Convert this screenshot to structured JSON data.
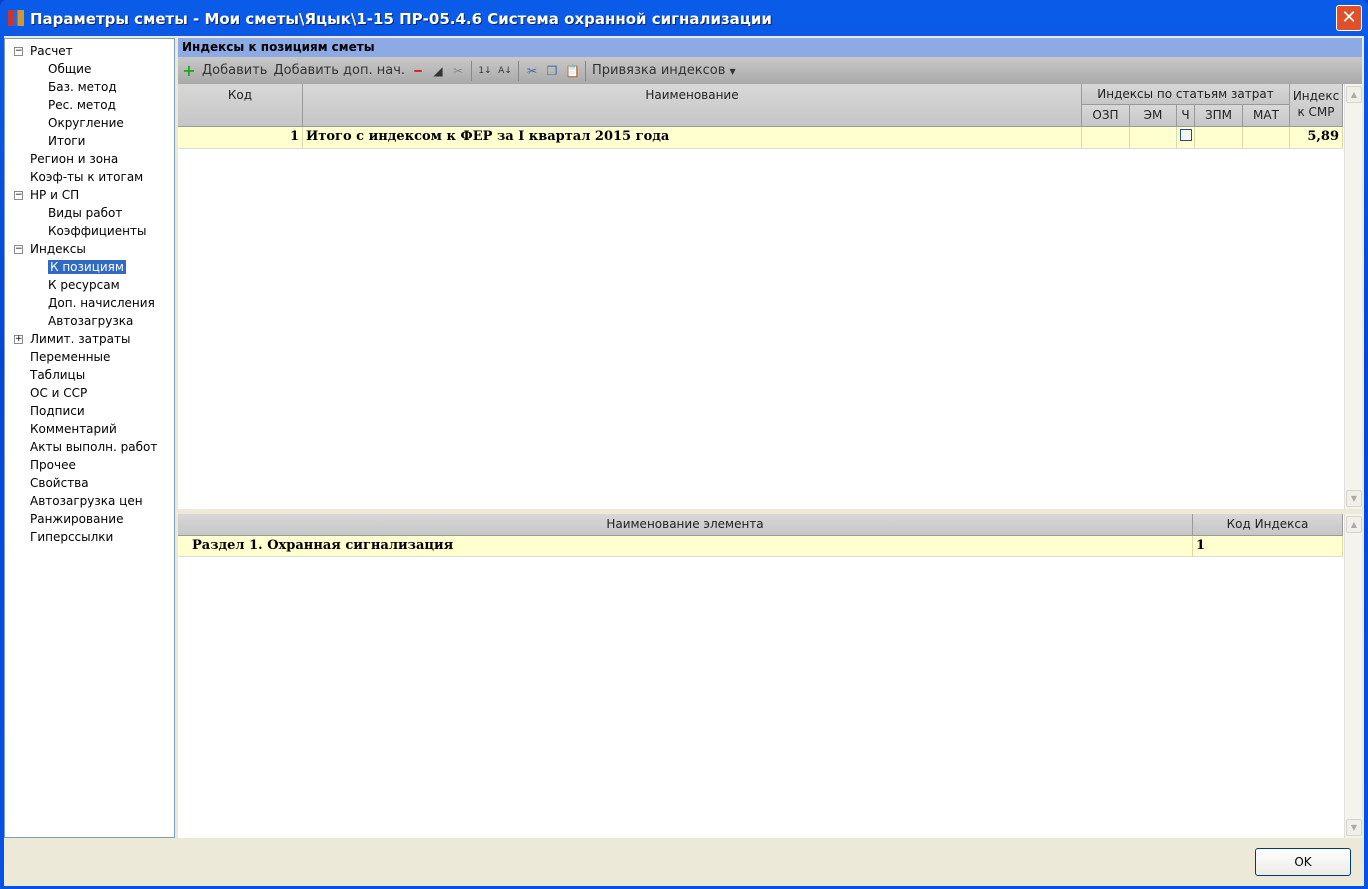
{
  "window": {
    "title": "Параметры сметы - Мои сметы\\Яцык\\1-15 ПР-05.4.6 Система охранной сигнализации"
  },
  "tree": [
    {
      "label": "Расчет",
      "level": 0,
      "exp": "minus"
    },
    {
      "label": "Общие",
      "level": 1
    },
    {
      "label": "Баз. метод",
      "level": 1
    },
    {
      "label": "Рес. метод",
      "level": 1
    },
    {
      "label": "Округление",
      "level": 1
    },
    {
      "label": "Итоги",
      "level": 1
    },
    {
      "label": "Регион и зона",
      "level": 0
    },
    {
      "label": "Коэф-ты к итогам",
      "level": 0
    },
    {
      "label": "НР и СП",
      "level": 0,
      "exp": "minus"
    },
    {
      "label": "Виды работ",
      "level": 1
    },
    {
      "label": "Коэффициенты",
      "level": 1
    },
    {
      "label": "Индексы",
      "level": 0,
      "exp": "minus"
    },
    {
      "label": "К позициям",
      "level": 1,
      "selected": true
    },
    {
      "label": "К ресурсам",
      "level": 1
    },
    {
      "label": "Доп. начисления",
      "level": 1
    },
    {
      "label": "Автозагрузка",
      "level": 1
    },
    {
      "label": "Лимит. затраты",
      "level": 0,
      "exp": "plus"
    },
    {
      "label": "Переменные",
      "level": 0
    },
    {
      "label": "Таблицы",
      "level": 0
    },
    {
      "label": "ОС и ССР",
      "level": 0
    },
    {
      "label": "Подписи",
      "level": 0
    },
    {
      "label": "Комментарий",
      "level": 0
    },
    {
      "label": "Акты выполн. работ",
      "level": 0
    },
    {
      "label": "Прочее",
      "level": 0
    },
    {
      "label": "Свойства",
      "level": 0
    },
    {
      "label": "Автозагрузка цен",
      "level": 0
    },
    {
      "label": "Ранжирование",
      "level": 0
    },
    {
      "label": "Гиперссылки",
      "level": 0
    }
  ],
  "panel": {
    "title": "Индексы к позициям сметы"
  },
  "toolbar": {
    "add": "Добавить",
    "add_extra": "Добавить доп. нач.",
    "bind": "Привязка индексов"
  },
  "grid1": {
    "headers": {
      "code": "Код",
      "name": "Наименование",
      "group": "Индексы по статьям затрат",
      "ozp": "ОЗП",
      "em": "ЭМ",
      "ch": "Ч",
      "zpm": "ЗПМ",
      "mat": "МАТ",
      "smr": "Индекс к СМР"
    },
    "rows": [
      {
        "code": "1",
        "name": "Итого с индексом к ФЕР за I квартал 2015 года",
        "ozp": "",
        "em": "",
        "zpm": "",
        "mat": "",
        "smr": "5,89"
      }
    ]
  },
  "grid2": {
    "headers": {
      "name": "Наименование элемента",
      "code": "Код Индекса"
    },
    "rows": [
      {
        "name": "Раздел 1. Охранная сигнализация",
        "code": "1"
      }
    ]
  },
  "buttons": {
    "ok": "OK"
  }
}
